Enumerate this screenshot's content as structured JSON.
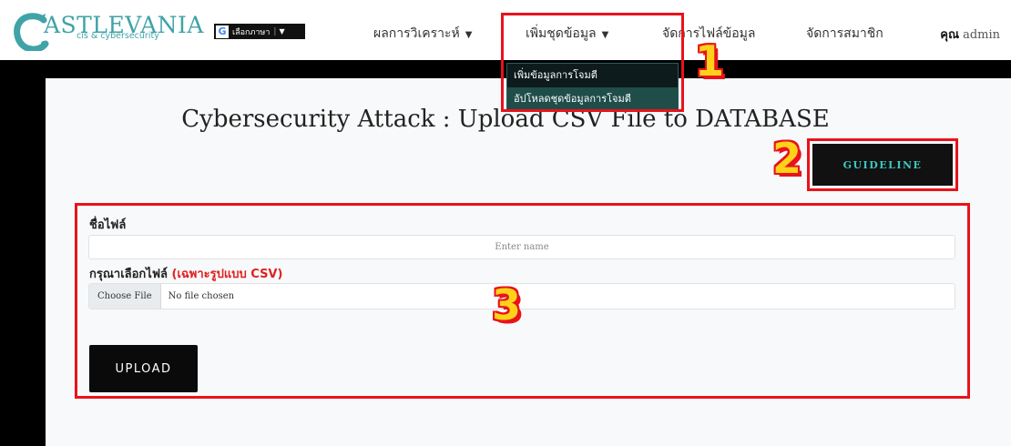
{
  "brand": {
    "logo_text": "ASTLEVANIA",
    "logo_subtitle": "cis & cybersecurity",
    "logo_mark": "C"
  },
  "translate": {
    "label": "เลือกภาษา",
    "separator": "|",
    "arrow": "▼",
    "icon": "google-g-icon"
  },
  "nav": {
    "items": [
      {
        "label": "ผลการวิเคราะห์",
        "caret": "▼"
      },
      {
        "label": "เพิ่มชุดข้อมูล",
        "caret": "▼"
      },
      {
        "label": "จัดการไฟล์ข้อมูล"
      },
      {
        "label": "จัดการสมาชิก"
      }
    ],
    "user_prefix": "คุณ",
    "user_name": "admin"
  },
  "dropdown": {
    "items": [
      {
        "label": "เพิ่มข้อมูลการโจมตี",
        "active": false
      },
      {
        "label": "อัปโหลดชุดข้อมูลการโจมตี",
        "active": true
      }
    ]
  },
  "page": {
    "title": "Cybersecurity Attack : Upload CSV File to DATABASE",
    "guideline_label": "GUIDELINE"
  },
  "form": {
    "name_label": "ชื่อไฟล์",
    "name_placeholder": "Enter name",
    "file_label": "กรุณาเลือกไฟล์",
    "file_note": "(เฉพาะรูปแบบ CSV)",
    "choose_file_label": "Choose File",
    "file_status": "No file chosen",
    "upload_label": "UPLOAD"
  },
  "annotations": {
    "labels": [
      "1",
      "2",
      "3"
    ],
    "box_color": "#e8131b",
    "number_color": "#ffd21a"
  },
  "colors": {
    "brand_teal": "#3fa3a8",
    "dropdown_bg": "#0d1b1c",
    "dropdown_active": "#1f4d4a",
    "guideline_text": "#3ec6c0"
  }
}
